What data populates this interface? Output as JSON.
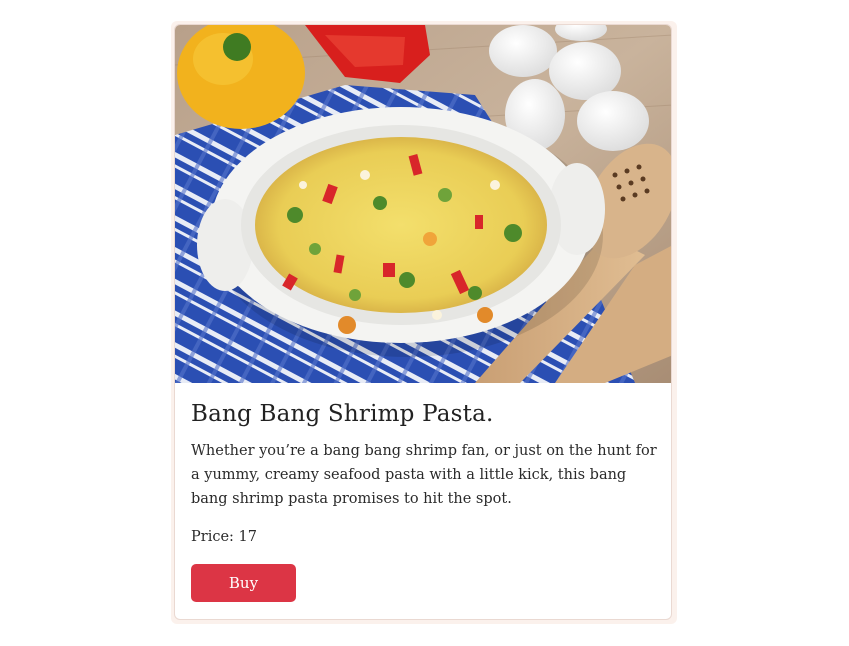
{
  "card": {
    "image_alt": "Baked vegetable frittata in a white oval dish with eggs, peppers and wooden spoons",
    "title": "Bang Bang Shrimp Pasta.",
    "description": "Whether you’re a bang bang shrimp fan, or just on the hunt for a yummy, creamy seafood pasta with a little kick, this bang bang shrimp pasta promises to hit the spot.",
    "price_text": "Price: 17",
    "buy_label": "Buy"
  },
  "colors": {
    "button": "#dc3545",
    "card_border": "#ead9d2",
    "card_glow": "#fbf1ec"
  }
}
